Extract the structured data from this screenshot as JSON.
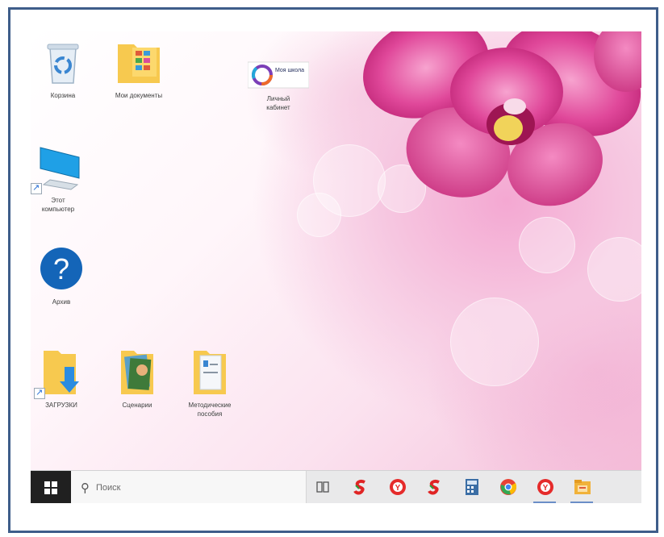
{
  "desktop": {
    "icons": [
      {
        "label": "Корзина",
        "icon": "recycle-bin-icon"
      },
      {
        "label": "Мои документы",
        "icon": "documents-folder-icon"
      },
      {
        "label": "Личный кабинет",
        "icon": "moya-shkola-app-icon",
        "badge": "Моя школа"
      },
      {
        "label": "Этот компьютер",
        "icon": "computer-icon"
      },
      {
        "label": "Архив",
        "icon": "help-icon"
      },
      {
        "label": "ЗАГРУЗКИ",
        "icon": "downloads-folder-icon"
      },
      {
        "label": "Сценарии",
        "icon": "pictures-folder-icon"
      },
      {
        "label": "Методические пособия",
        "icon": "folder-icon"
      }
    ]
  },
  "taskbar": {
    "search_placeholder": "Поиск",
    "pinned": [
      {
        "icon": "task-view-icon"
      },
      {
        "icon": "app-red-s-icon"
      },
      {
        "icon": "yandex-browser-icon"
      },
      {
        "icon": "app-red-s-icon"
      },
      {
        "icon": "calculator-icon"
      },
      {
        "icon": "chrome-icon"
      },
      {
        "icon": "yandex-browser-icon",
        "active": true
      },
      {
        "icon": "file-explorer-icon",
        "active": true
      }
    ]
  },
  "colors": {
    "frame_border": "#3e5d8a",
    "taskbar_bg": "#e9e9ea",
    "start_bg": "#202020",
    "accent_underline": "#6b8ec7"
  }
}
